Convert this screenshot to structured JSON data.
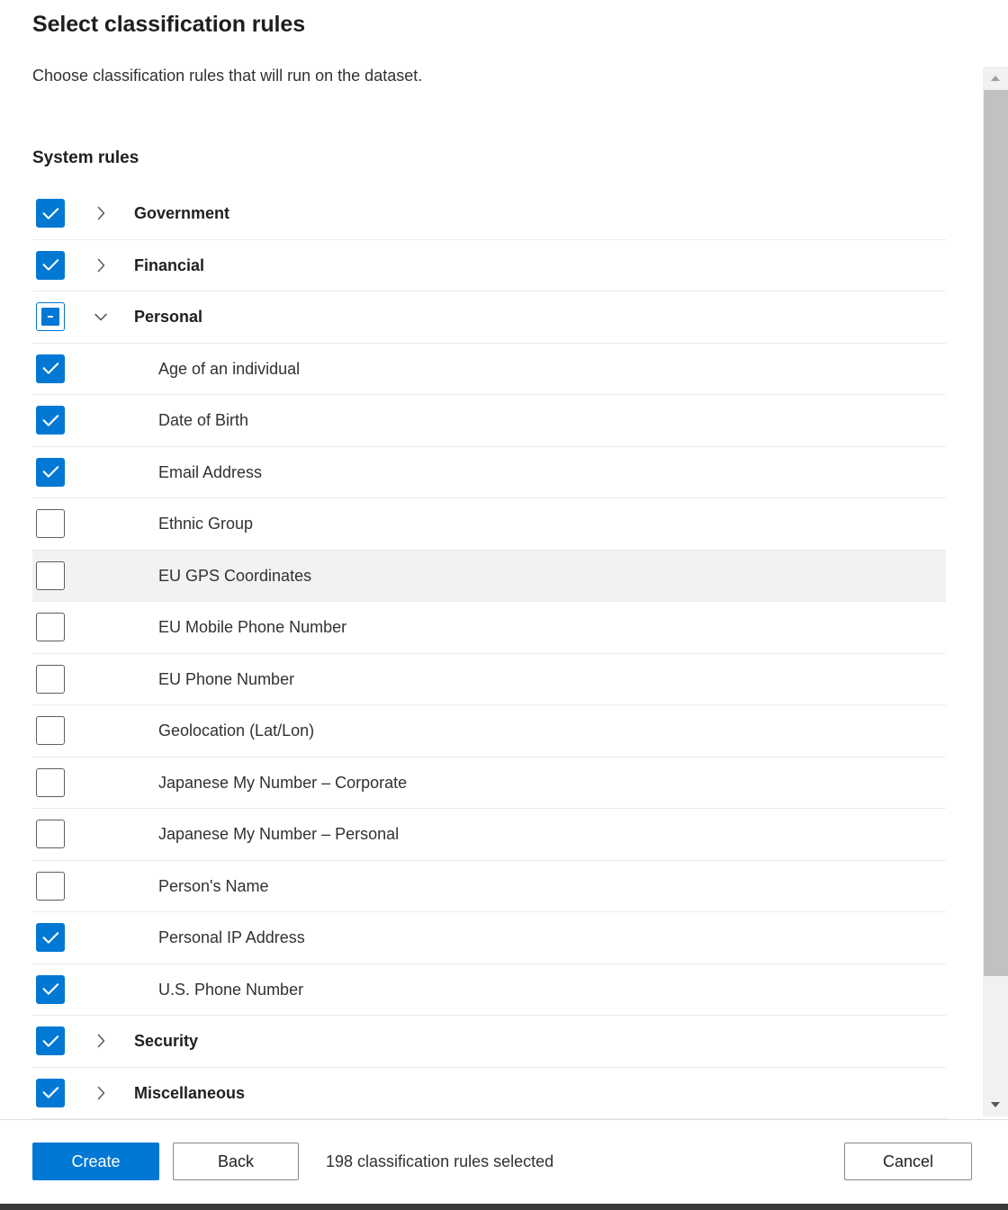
{
  "header": {
    "title": "Select classification rules",
    "subtitle": "Choose classification rules that will run on the dataset.",
    "section_title": "System rules"
  },
  "rules": [
    {
      "label": "Government",
      "level": "group",
      "checkbox": "checked",
      "chevron": "chevron-right-icon",
      "hovered": false
    },
    {
      "label": "Financial",
      "level": "group",
      "checkbox": "checked",
      "chevron": "chevron-right-icon",
      "hovered": false
    },
    {
      "label": "Personal",
      "level": "group",
      "checkbox": "indeterminate",
      "chevron": "chevron-down-icon",
      "hovered": false
    },
    {
      "label": "Age of an individual",
      "level": "child",
      "checkbox": "checked",
      "chevron": "none",
      "hovered": false
    },
    {
      "label": "Date of Birth",
      "level": "child",
      "checkbox": "checked",
      "chevron": "none",
      "hovered": false
    },
    {
      "label": "Email Address",
      "level": "child",
      "checkbox": "checked",
      "chevron": "none",
      "hovered": false
    },
    {
      "label": "Ethnic Group",
      "level": "child",
      "checkbox": "unchecked",
      "chevron": "none",
      "hovered": false
    },
    {
      "label": "EU GPS Coordinates",
      "level": "child",
      "checkbox": "unchecked",
      "chevron": "none",
      "hovered": true
    },
    {
      "label": "EU Mobile Phone Number",
      "level": "child",
      "checkbox": "unchecked",
      "chevron": "none",
      "hovered": false
    },
    {
      "label": "EU Phone Number",
      "level": "child",
      "checkbox": "unchecked",
      "chevron": "none",
      "hovered": false
    },
    {
      "label": "Geolocation (Lat/Lon)",
      "level": "child",
      "checkbox": "unchecked",
      "chevron": "none",
      "hovered": false
    },
    {
      "label": "Japanese My Number – Corporate",
      "level": "child",
      "checkbox": "unchecked",
      "chevron": "none",
      "hovered": false
    },
    {
      "label": "Japanese My Number – Personal",
      "level": "child",
      "checkbox": "unchecked",
      "chevron": "none",
      "hovered": false
    },
    {
      "label": "Person's Name",
      "level": "child",
      "checkbox": "unchecked",
      "chevron": "none",
      "hovered": false
    },
    {
      "label": "Personal IP Address",
      "level": "child",
      "checkbox": "checked",
      "chevron": "none",
      "hovered": false
    },
    {
      "label": "U.S. Phone Number",
      "level": "child",
      "checkbox": "checked",
      "chevron": "none",
      "hovered": false
    },
    {
      "label": "Security",
      "level": "group",
      "checkbox": "checked",
      "chevron": "chevron-right-icon",
      "hovered": false
    },
    {
      "label": "Miscellaneous",
      "level": "group",
      "checkbox": "checked",
      "chevron": "chevron-right-icon",
      "hovered": false
    }
  ],
  "scrollbar": {
    "up_arrow": "scroll-up-arrow-icon",
    "down_arrow": "scroll-down-arrow-icon"
  },
  "footer": {
    "create_label": "Create",
    "back_label": "Back",
    "cancel_label": "Cancel",
    "selected_count_text": "198 classification rules selected"
  },
  "colors": {
    "accent": "#0078d4",
    "row_hover": "#f3f2f1",
    "row_divider": "#edebe9",
    "scrollbar_thumb": "#c1c1c1",
    "scrollbar_track": "#f1f1f1",
    "bottom_bar": "#3b3a39"
  }
}
